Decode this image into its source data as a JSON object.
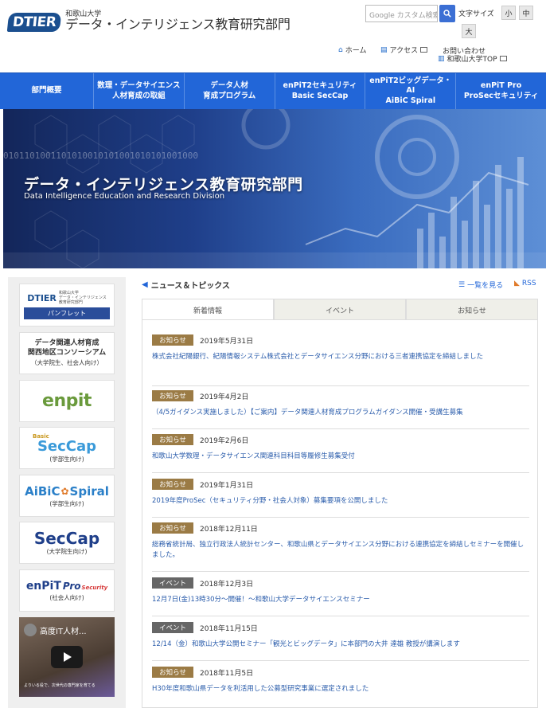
{
  "header": {
    "logo_mark": "DTIER",
    "university": "和歌山大学",
    "division": "データ・インテリジェンス教育研究部門",
    "search_placeholder": "Google カスタム検索",
    "font_size_label": "文字サイズ",
    "font_sizes": [
      "小",
      "中",
      "大"
    ],
    "links": {
      "home": "ホーム",
      "access": "アクセス",
      "contact": "お問い合わせ",
      "univ_top": "和歌山大学TOP"
    }
  },
  "nav": [
    {
      "label": "部門概要"
    },
    {
      "label": "数理・データサイエンス人材育成の取組"
    },
    {
      "label": "データ人材\n育成プログラム"
    },
    {
      "label": "enPiT2セキュリティ\nBasic SecCap"
    },
    {
      "label": "enPiT2ビッグデータ・AI\nAiBiC Spiral"
    },
    {
      "label": "enPiT Pro\nProSecセキュリティ"
    }
  ],
  "hero": {
    "binary": "0101101001101010010101001010101001000",
    "title": "データ・インテリジェンス教育研究部門",
    "subtitle": "Data Intelligence Education and Research Division"
  },
  "sidebar": {
    "pamphlet": {
      "logo": "DTIER",
      "caption": "和歌山大学\nデータ・インテリジェンス\n教育研究部門",
      "button": "パンフレット"
    },
    "consortium": {
      "title": "データ関連人材育成\n関西地区コンソーシアム",
      "note": "（大学院生、社会人向け）"
    },
    "enpit": {
      "logo": "enpit"
    },
    "basic_seccap": {
      "small": "Basic",
      "logo": "SecCap",
      "note": "(学部生向け)"
    },
    "aibic": {
      "logo": "AiBiC",
      "logo2": "Spiral",
      "note": "(学部生向け)"
    },
    "seccap": {
      "logo": "SecCap",
      "note": "(大学院生向け)"
    },
    "enpit_pro": {
      "logo": "enPiT",
      "pro": "Pro",
      "sec": "Security",
      "note": "(社会人向け)"
    },
    "video": {
      "title": "高度IT人材...",
      "caption": "よりいる役で、次世代の専門家を育てる"
    }
  },
  "news": {
    "heading": "ニュース＆トピックス",
    "list_link": "一覧を見る",
    "rss": "RSS",
    "tabs": [
      "新着情報",
      "イベント",
      "お知らせ"
    ],
    "items": [
      {
        "category": "お知らせ",
        "type": "notice",
        "date": "2019年5月31日",
        "title": "株式会社紀陽銀行、紀陽情報システム株式会社とデータサイエンス分野における三者連携協定を締結しました"
      },
      {
        "category": "お知らせ",
        "type": "notice",
        "date": "2019年4月2日",
        "title": "（4/5ガイダンス実施しました）【ご案内】データ関連人材育成プログラムガイダンス開催・受講生募集"
      },
      {
        "category": "お知らせ",
        "type": "notice",
        "date": "2019年2月6日",
        "title": "和歌山大学数理・データサイエンス関連科目科目等履修生募集受付"
      },
      {
        "category": "お知らせ",
        "type": "notice",
        "date": "2019年1月31日",
        "title": "2019年度ProSec（セキュリティ分野・社会人対象）募集要項を公開しました"
      },
      {
        "category": "お知らせ",
        "type": "notice",
        "date": "2018年12月11日",
        "title": "総務省統計局、独立行政法人統計センター、和歌山県とデータサイエンス分野における連携協定を締結しセミナーを開催しました。"
      },
      {
        "category": "イベント",
        "type": "event",
        "date": "2018年12月3日",
        "title": "12月7日(金)13時30分～開催！～和歌山大学データサイエンスセミナー"
      },
      {
        "category": "イベント",
        "type": "event",
        "date": "2018年11月15日",
        "title": "12/14（金）和歌山大学公開セミナー「観光とビッグデータ」に本部門の大井 達雄 教授が講演します"
      },
      {
        "category": "お知らせ",
        "type": "notice",
        "date": "2018年11月5日",
        "title": "H30年度和歌山県データを利活用した公募型研究事業に選定されました"
      }
    ]
  },
  "colors": {
    "nav": "#2266d8",
    "badge_notice": "#9b7b45",
    "badge_event": "#666666",
    "link": "#2a5cab"
  }
}
